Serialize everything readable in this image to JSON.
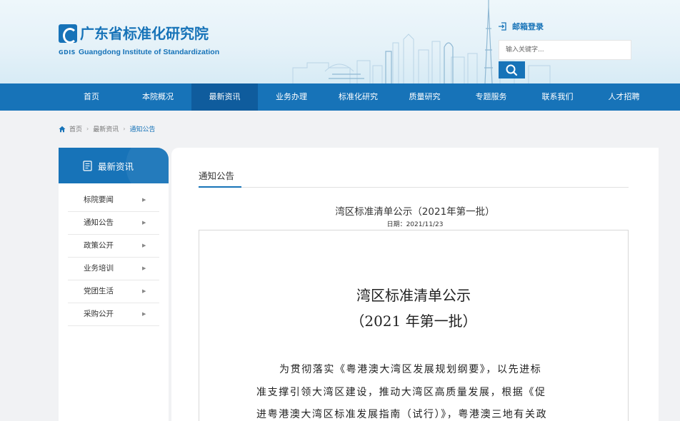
{
  "header": {
    "logo_cn": "广东省标准化研究院",
    "logo_abbr": "GDIS",
    "logo_en": "Guangdong Institute of Standardization",
    "mail_login": "邮箱登录",
    "search_placeholder": "输入关键字...",
    "accent_color": "#1773b8"
  },
  "nav": {
    "items": [
      {
        "label": "首页"
      },
      {
        "label": "本院概况"
      },
      {
        "label": "最新资讯"
      },
      {
        "label": "业务办理"
      },
      {
        "label": "标准化研究"
      },
      {
        "label": "质量研究"
      },
      {
        "label": "专题服务"
      },
      {
        "label": "联系我们"
      },
      {
        "label": "人才招聘"
      }
    ],
    "active": "最新资讯"
  },
  "breadcrumb": {
    "home": "首页",
    "level1": "最新资讯",
    "current": "通知公告"
  },
  "sidebar": {
    "title": "最新资讯",
    "items": [
      {
        "label": "标院要闻"
      },
      {
        "label": "通知公告"
      },
      {
        "label": "政策公开"
      },
      {
        "label": "业务培训"
      },
      {
        "label": "党团生活"
      },
      {
        "label": "采购公开"
      }
    ]
  },
  "main": {
    "tab_title": "通知公告",
    "article_title": "湾区标准清单公示（2021年第一批）",
    "article_date": "日期：2021/11/23",
    "doc_title": "湾区标准清单公示",
    "doc_subtitle": "（2021 年第一批）",
    "doc_lines": [
      "为贯彻落实《粤港澳大湾区发展规划纲要》，以先进标",
      "准支撑引领大湾区建设，推动大湾区高质量发展，根据《促",
      "进粤港澳大湾区标准发展指南（试行）》，粤港澳三地有关政"
    ]
  }
}
